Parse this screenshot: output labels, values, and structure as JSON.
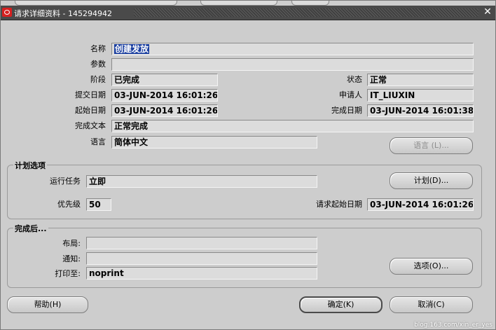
{
  "window": {
    "title": "请求详细资料 - 145294942"
  },
  "details": {
    "name_label": "名称",
    "name_value": "创建发放",
    "params_label": "参数",
    "params_value": "",
    "phase_label": "阶段",
    "phase_value": "已完成",
    "status_label": "状态",
    "status_value": "正常",
    "submit_date_label": "提交日期",
    "submit_date_value": "03-JUN-2014 16:01:26",
    "requester_label": "申请人",
    "requester_value": "IT_LIUXIN",
    "start_date_label": "起始日期",
    "start_date_value": "03-JUN-2014 16:01:26",
    "completion_date_label": "完成日期",
    "completion_date_value": "03-JUN-2014 16:01:38",
    "completion_text_label": "完成文本",
    "completion_text_value": "正常完成",
    "language_label": "语言",
    "language_value": "简体中文",
    "language_button": "语言 (L)..."
  },
  "schedule": {
    "group_title": "计划选项",
    "run_job_label": "运行任务",
    "run_job_value": "立即",
    "schedule_button": "计划(D)...",
    "priority_label": "优先级",
    "priority_value": "50",
    "request_start_label": "请求起始日期",
    "request_start_value": "03-JUN-2014 16:01:26"
  },
  "upon_completion": {
    "group_title": "完成后...",
    "layout_label": "布局:",
    "layout_value": "",
    "notify_label": "通知:",
    "notify_value": "",
    "print_to_label": "打印至:",
    "print_to_value": "noprint",
    "options_button": "选项(O)..."
  },
  "footer": {
    "help_button": "帮助(H)",
    "ok_button": "确定(K)",
    "cancel_button": "取消(C)"
  },
  "watermark": "blog.163.com/xin_er_yes"
}
